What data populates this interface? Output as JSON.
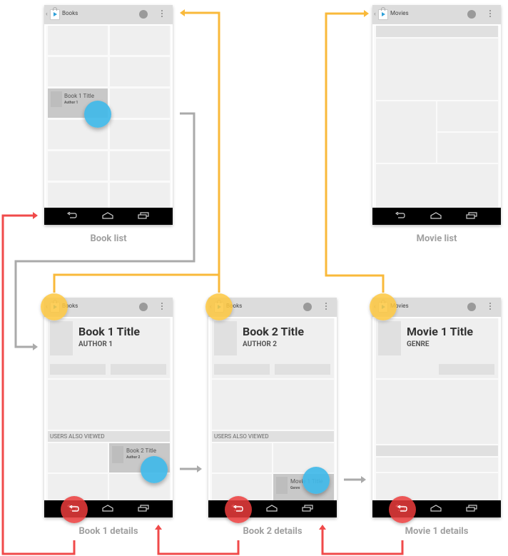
{
  "colors": {
    "up_flow": "#f9b93a",
    "back_flow": "#f04a4a",
    "forward_flow": "#aaaaaa",
    "touch": "#40b8e8",
    "caption": "#a0a0a0"
  },
  "screens": {
    "book_list": {
      "app_title": "Books",
      "caption": "Book list",
      "selected_card": {
        "title": "Book 1 Title",
        "subtitle": "Author 1"
      }
    },
    "movie_list": {
      "app_title": "Movies",
      "caption": "Movie list"
    },
    "book1_details": {
      "app_title": "Books",
      "title": "Book 1 Title",
      "subtitle": "AUTHOR 1",
      "section_label": "USERS ALSO VIEWED",
      "related_card": {
        "title": "Book 2 Title",
        "subtitle": "Author 2"
      },
      "caption": "Book 1 details"
    },
    "book2_details": {
      "app_title": "Books",
      "title": "Book 2 Title",
      "subtitle": "AUTHOR 2",
      "section_label": "USERS ALSO VIEWED",
      "related_card": {
        "title": "Movie 1 Title",
        "subtitle": "Genre"
      },
      "caption": "Book 2 details"
    },
    "movie1_details": {
      "app_title": "Movies",
      "title": "Movie 1 Title",
      "subtitle": "GENRE",
      "caption": "Movie 1 details"
    }
  },
  "icons": {
    "back_chevron": "‹",
    "app_icon": "play-store-bag-icon",
    "overflow": "overflow-menu-icon",
    "nav_back": "nav-back-icon",
    "nav_home": "nav-home-icon",
    "nav_recent": "nav-recent-icon"
  }
}
